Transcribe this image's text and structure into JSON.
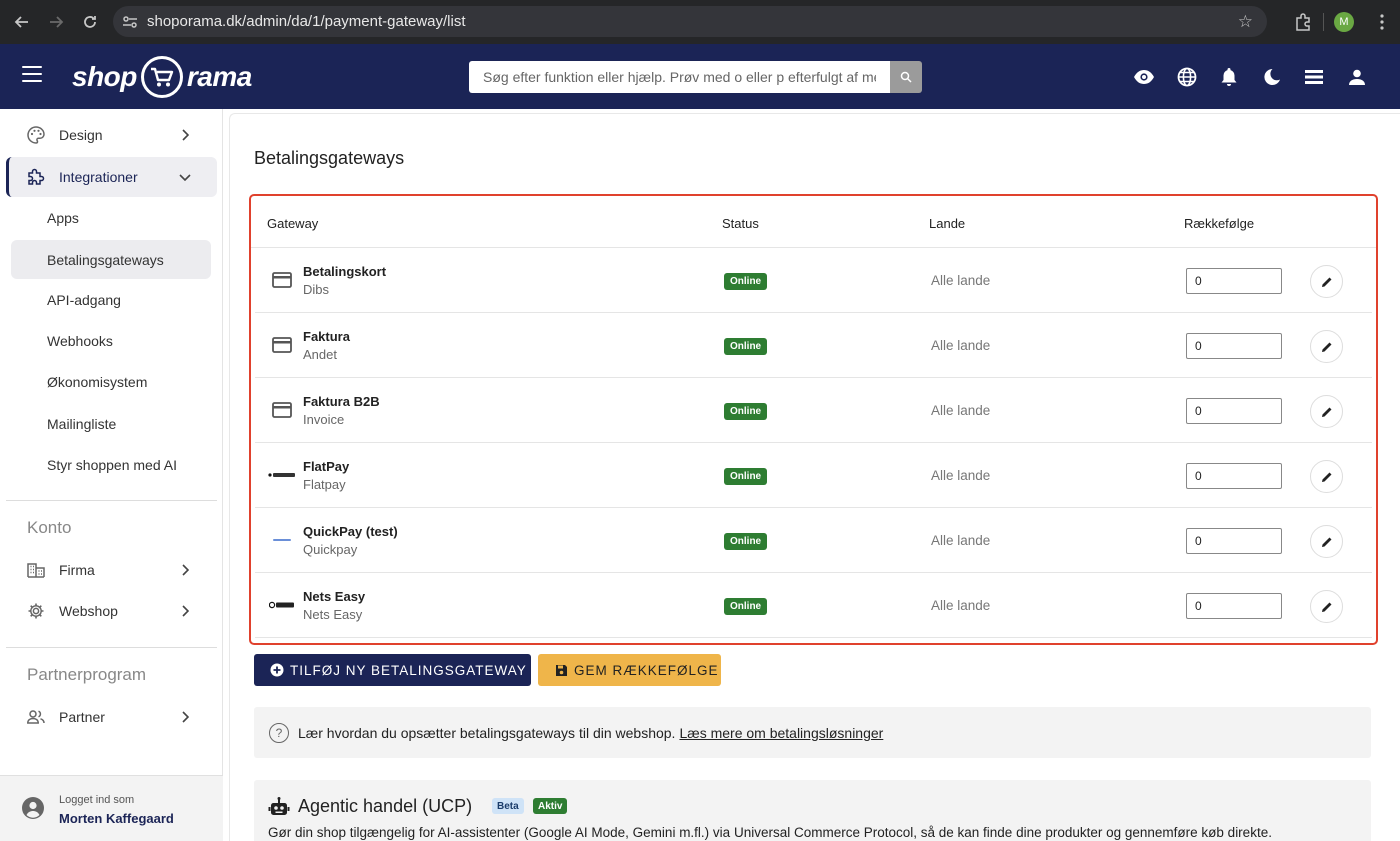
{
  "browser": {
    "url": "shoporama.dk/admin/da/1/payment-gateway/list",
    "profile_initial": "M"
  },
  "header": {
    "logo_left": "shop",
    "logo_right": "rama",
    "search_placeholder": "Søg efter funktion eller hjælp. Prøv med o eller p efterfulgt af mellemrum",
    "icons": [
      "eye-icon",
      "globe-icon",
      "bell-icon",
      "moon-icon",
      "menu-lines-icon",
      "user-icon"
    ]
  },
  "sidebar": {
    "design": "Design",
    "integrations": "Integrationer",
    "sub_items": [
      "Apps",
      "Betalingsgateways",
      "API-adgang",
      "Webhooks",
      "Økonomisystem",
      "Mailingliste",
      "Styr shoppen med AI"
    ],
    "selected_sub": "Betalingsgateways",
    "account_heading": "Konto",
    "firma": "Firma",
    "webshop": "Webshop",
    "partner_heading": "Partnerprogram",
    "partner": "Partner",
    "logged_in_label": "Logget ind som",
    "user_name": "Morten Kaffegaard"
  },
  "main": {
    "title": "Betalingsgateways",
    "columns": {
      "gateway": "Gateway",
      "status": "Status",
      "countries": "Lande",
      "order": "Rækkefølge"
    },
    "rows": [
      {
        "name": "Betalingskort",
        "provider": "Dibs",
        "status": "Online",
        "countries": "Alle lande",
        "order": "0",
        "icon": "credit-card-icon"
      },
      {
        "name": "Faktura",
        "provider": "Andet",
        "status": "Online",
        "countries": "Alle lande",
        "order": "0",
        "icon": "credit-card-icon"
      },
      {
        "name": "Faktura B2B",
        "provider": "Invoice",
        "status": "Online",
        "countries": "Alle lande",
        "order": "0",
        "icon": "credit-card-icon"
      },
      {
        "name": "FlatPay",
        "provider": "Flatpay",
        "status": "Online",
        "countries": "Alle lande",
        "order": "0",
        "icon": "flatpay-logo"
      },
      {
        "name": "QuickPay (test)",
        "provider": "Quickpay",
        "status": "Online",
        "countries": "Alle lande",
        "order": "0",
        "icon": "quickpay-logo"
      },
      {
        "name": "Nets Easy",
        "provider": "Nets Easy",
        "status": "Online",
        "countries": "Alle lande",
        "order": "0",
        "icon": "nets-logo"
      }
    ],
    "add_button": "TILFØJ NY BETALINGSGATEWAY",
    "save_button": "GEM RÆKKEFØLGE",
    "info_text": "Lær hvordan du opsætter betalingsgateways til din webshop.",
    "info_link": "Læs mere om betalingsløsninger",
    "agentic": {
      "title": "Agentic handel (UCP)",
      "badge_beta": "Beta",
      "badge_active": "Aktiv",
      "description": "Gør din shop tilgængelig for AI-assistenter (Google AI Mode, Gemini m.fl.) via Universal Commerce Protocol, så de kan finde dine produkter og gennemføre køb direkte."
    }
  },
  "colors": {
    "brand_navy": "#1b2456",
    "status_green": "#2e7d32",
    "save_yellow": "#efb54a",
    "highlight_red": "#e0412d"
  }
}
